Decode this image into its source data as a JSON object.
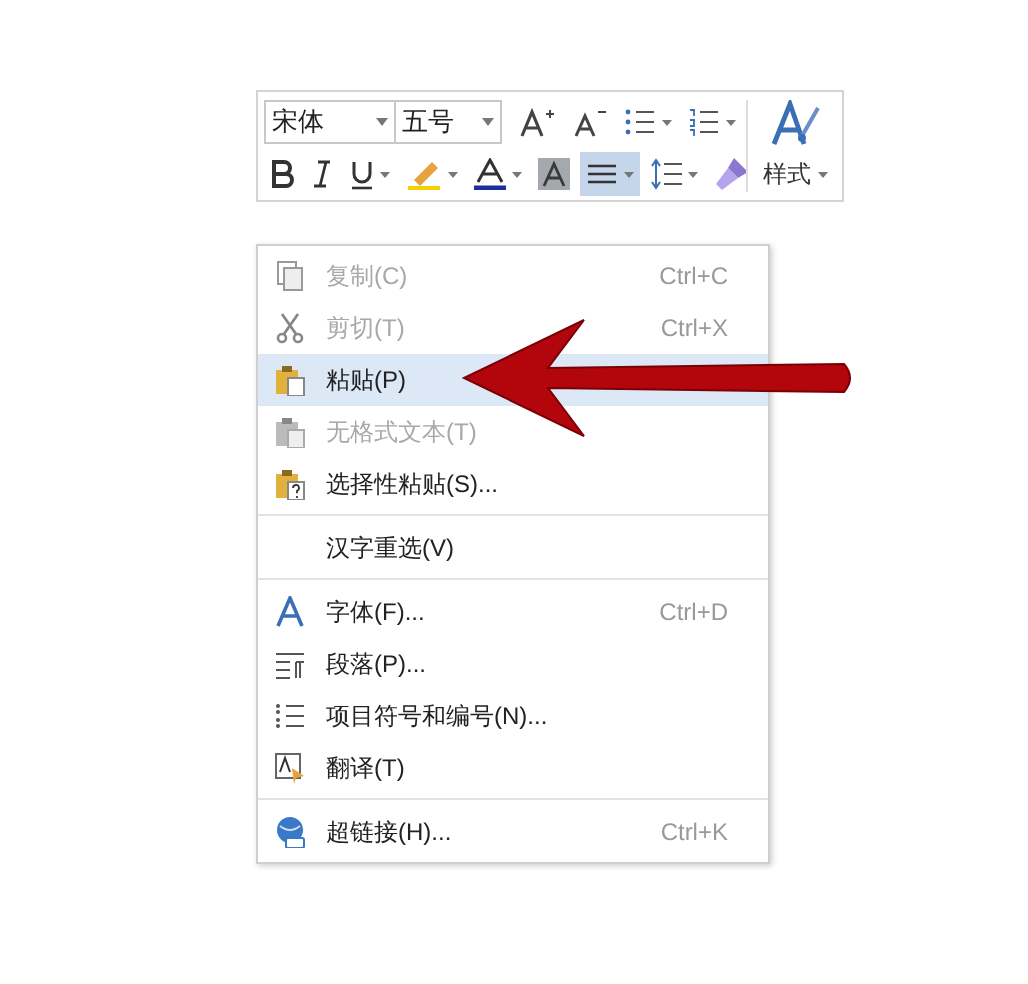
{
  "toolbar": {
    "font_name": "宋体",
    "font_size": "五号",
    "styles_label": "样式",
    "row1_buttons": [
      {
        "kind": "grow_font",
        "selected": false
      },
      {
        "kind": "shrink_font",
        "selected": false
      },
      {
        "kind": "bullets",
        "selected": false
      },
      {
        "kind": "numbering",
        "selected": false
      }
    ],
    "row2_buttons": [
      {
        "kind": "bold",
        "selected": false
      },
      {
        "kind": "italic",
        "selected": false
      },
      {
        "kind": "underline",
        "selected": false
      },
      {
        "kind": "highlight",
        "selected": false
      },
      {
        "kind": "font_color",
        "selected": false
      },
      {
        "kind": "char_shading",
        "selected": false
      },
      {
        "kind": "align",
        "selected": true
      },
      {
        "kind": "line_spacing",
        "selected": false
      },
      {
        "kind": "format_painter",
        "selected": false
      }
    ]
  },
  "context_menu": {
    "items": [
      {
        "kind": "copy",
        "label": "复制(C)",
        "shortcut": "Ctrl+C",
        "disabled": true,
        "selected": false,
        "separator_before": false
      },
      {
        "kind": "cut",
        "label": "剪切(T)",
        "shortcut": "Ctrl+X",
        "disabled": true,
        "selected": false,
        "separator_before": false
      },
      {
        "kind": "paste",
        "label": "粘贴(P)",
        "disabled": false,
        "selected": true,
        "separator_before": false
      },
      {
        "kind": "paste_plain",
        "label": "无格式文本(T)",
        "disabled": true,
        "selected": false,
        "separator_before": false
      },
      {
        "kind": "paste_special",
        "label": "选择性粘贴(S)...",
        "disabled": false,
        "selected": false,
        "separator_before": false
      },
      {
        "kind": "reselect",
        "label": "汉字重选(V)",
        "disabled": false,
        "selected": false,
        "separator_before": true
      },
      {
        "kind": "font",
        "label": "字体(F)...",
        "shortcut": "Ctrl+D",
        "disabled": false,
        "selected": false,
        "separator_before": true
      },
      {
        "kind": "paragraph",
        "label": "段落(P)...",
        "disabled": false,
        "selected": false,
        "separator_before": false
      },
      {
        "kind": "list",
        "label": "项目符号和编号(N)...",
        "disabled": false,
        "selected": false,
        "separator_before": false
      },
      {
        "kind": "translate",
        "label": "翻译(T)",
        "disabled": false,
        "selected": false,
        "separator_before": false
      },
      {
        "kind": "hyperlink",
        "label": "超链接(H)...",
        "shortcut": "Ctrl+K",
        "disabled": false,
        "selected": false,
        "separator_before": true
      }
    ]
  }
}
